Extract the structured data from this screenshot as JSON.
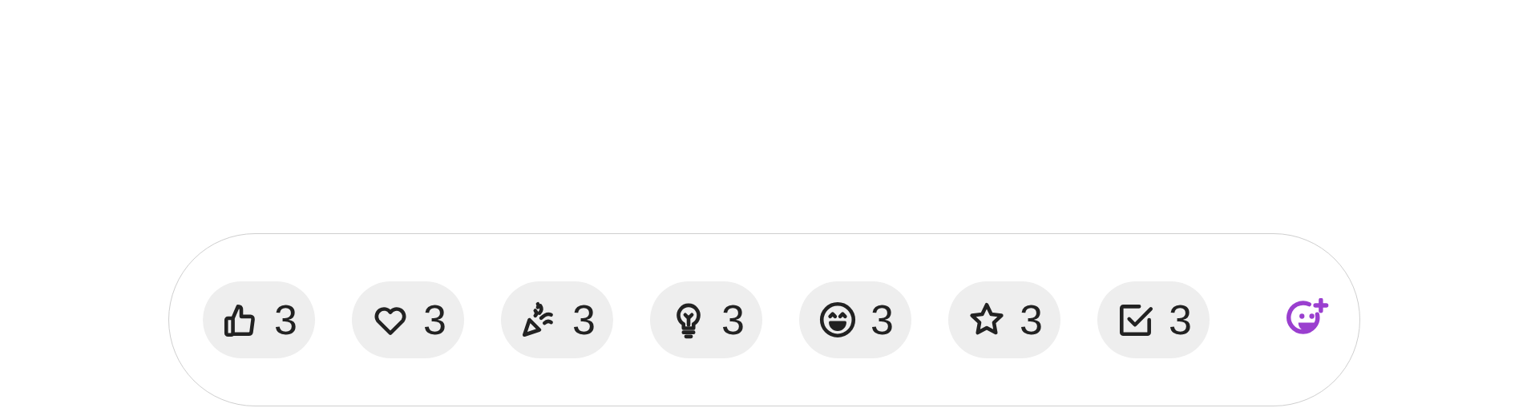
{
  "reactions": [
    {
      "kind": "thumbs-up",
      "count": "3"
    },
    {
      "kind": "heart",
      "count": "3"
    },
    {
      "kind": "party",
      "count": "3"
    },
    {
      "kind": "bulb",
      "count": "3"
    },
    {
      "kind": "grin",
      "count": "3"
    },
    {
      "kind": "star",
      "count": "3"
    },
    {
      "kind": "check",
      "count": "3"
    }
  ],
  "add_reaction": {
    "color": "#9a3fcf"
  }
}
